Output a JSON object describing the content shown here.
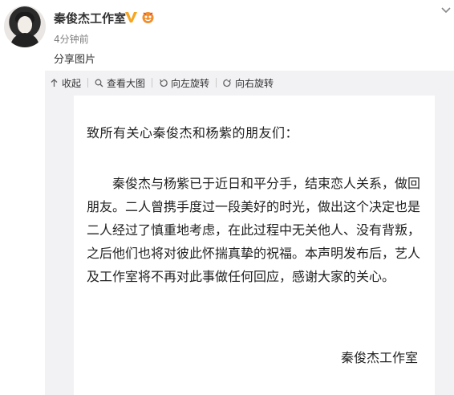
{
  "post": {
    "username": "秦俊杰工作室",
    "time": "4分钟前",
    "text": "分享图片"
  },
  "icons": {
    "verified": "verified-v-icon",
    "badge": "fan-badge-icon",
    "more": "chevron-down-icon"
  },
  "colors": {
    "verified": "#f5a623",
    "badge": "#f08f2c",
    "media_bg": "#f2f2f5"
  },
  "toolbar": {
    "collapse": "收起",
    "view_large": "查看大图",
    "rotate_left": "向左旋转",
    "rotate_right": "向右旋转"
  },
  "letter": {
    "salutation": "致所有关心秦俊杰和杨紫的朋友们：",
    "body": "秦俊杰与杨紫已于近日和平分手，结束恋人关系，做回朋友。二人曾携手度过一段美好的时光，做出这个决定也是二人经过了慎重地考虑，在此过程中无关他人、没有背叛，之后他们也将对彼此怀揣真挚的祝福。本声明发布后，艺人及工作室将不再对此事做任何回应，感谢大家的关心。",
    "signature": "秦俊杰工作室"
  }
}
